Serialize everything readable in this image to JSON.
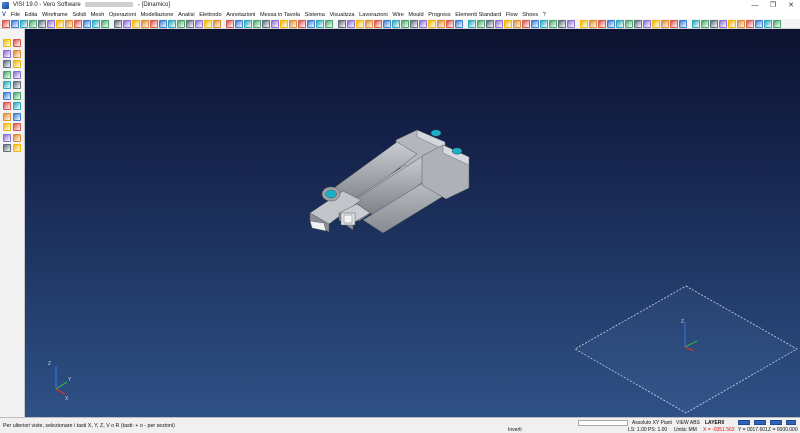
{
  "titlebar": {
    "title_prefix": "VISI 19.0 - Vero Software",
    "title_suffix": "- [Dinamico]",
    "minimize": "—",
    "maximize": "❐",
    "close": "✕"
  },
  "menu": {
    "items": [
      "File",
      "Edita",
      "Wireframe",
      "Solidi",
      "Mesh",
      "Operazioni",
      "Modellazione",
      "Analisi",
      "Elettrodo",
      "Annotazioni",
      "Messa in Tavola",
      "Sistema",
      "Visualizza",
      "Lavorazioni",
      "Wire",
      "Mould",
      "Progress",
      "Elementi Standard",
      "Flow",
      "Shoes",
      "?"
    ]
  },
  "viewport": {
    "axis_labels": {
      "z": "Z",
      "y": "Y",
      "x": "X"
    },
    "colors": {
      "axis_x": "#e03030",
      "axis_y": "#2fb040",
      "axis_z": "#3a6fe0",
      "part": "#a9adb3",
      "bore": "#1ab0c8"
    }
  },
  "statusbar": {
    "hint": "Per ulteriori viste, selezionare i tasti X, Y, Z, V o R (tasti: + o - per sezioni)",
    "inverti": "Inverti",
    "assoluto": "Assoluto XY Piant",
    "view": "VIEW ABS",
    "layer": "LAYER0",
    "scale": "LS: 1.00 PS: 1.00",
    "unit": "Unità: MM",
    "coord_x": "X = -0351.563",
    "coord_y": "Y = 0017.601",
    "coord_z": "Z = 0000.000"
  }
}
